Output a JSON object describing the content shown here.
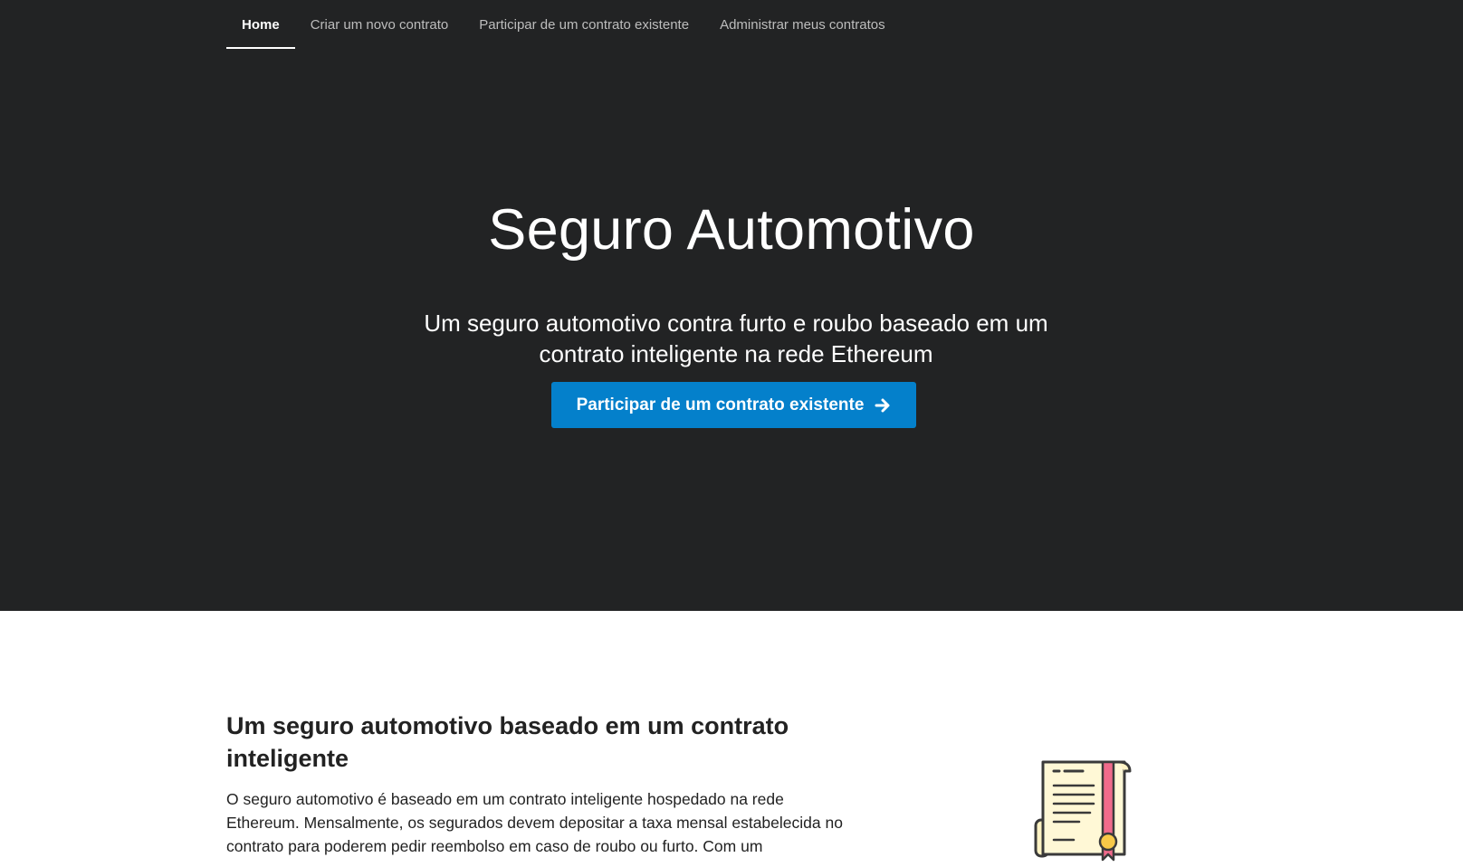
{
  "nav": {
    "items": [
      {
        "label": "Home",
        "active": true
      },
      {
        "label": "Criar um novo contrato",
        "active": false
      },
      {
        "label": "Participar de um contrato existente",
        "active": false
      },
      {
        "label": "Administrar meus contratos",
        "active": false
      }
    ]
  },
  "hero": {
    "title": "Seguro Automotivo",
    "subtitle": "Um seguro automotivo contra furto e roubo baseado em um contrato inteligente na rede Ethereum",
    "cta_label": "Participar de um contrato existente",
    "cta_icon": "arrow-right-icon"
  },
  "section": {
    "title": "Um seguro automotivo baseado em um contrato inteligente",
    "body": "O seguro automotivo é baseado em um contrato inteligente hospedado na rede Ethereum. Mensalmente, os segurados devem depositar a taxa mensal estabelecida no contrato para poderem pedir reembolso em caso de roubo ou furto. Com um",
    "illustration": "contract-scroll-icon"
  },
  "colors": {
    "hero_background": "#222324",
    "accent": "#0480cb",
    "text_dark": "#222222"
  }
}
